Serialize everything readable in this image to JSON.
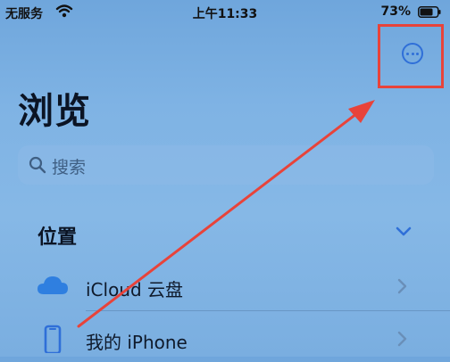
{
  "status_bar": {
    "carrier": "无服务",
    "time": "上午11:33",
    "battery": "73%"
  },
  "header": {
    "title": "浏览",
    "more_icon": "ellipsis-circle-icon"
  },
  "search": {
    "placeholder": "搜索",
    "icon": "search-icon"
  },
  "locations": {
    "title": "位置",
    "items": [
      {
        "label": "iCloud 云盘",
        "icon": "icloud-icon"
      },
      {
        "label": "我的 iPhone",
        "icon": "iphone-icon"
      }
    ]
  },
  "colors": {
    "accent": "#2f6fd8",
    "annotation": "#e8433a"
  }
}
